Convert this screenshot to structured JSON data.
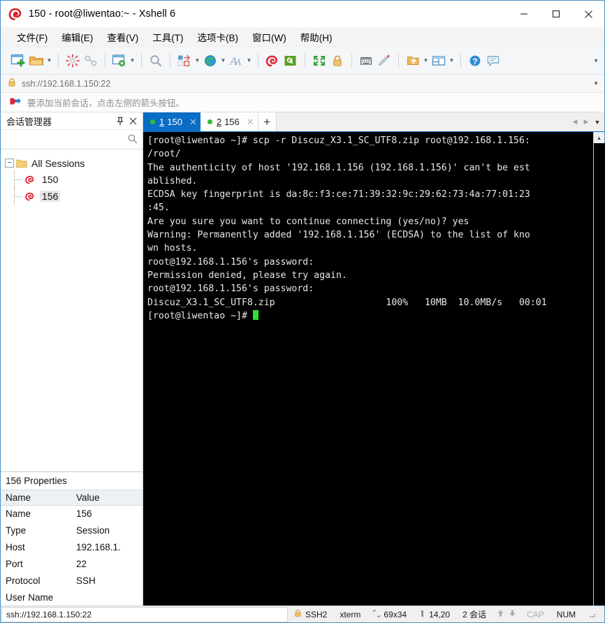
{
  "window": {
    "title": "150 - root@liwentao:~ - Xshell 6",
    "app_icon": "xshell-logo-icon",
    "controls": {
      "minimize": "—",
      "maximize": "□",
      "close": "✕"
    }
  },
  "menu": {
    "items": [
      {
        "label": "文件(F)",
        "name": "menu-file"
      },
      {
        "label": "编辑(E)",
        "name": "menu-edit"
      },
      {
        "label": "查看(V)",
        "name": "menu-view"
      },
      {
        "label": "工具(T)",
        "name": "menu-tools"
      },
      {
        "label": "选项卡(B)",
        "name": "menu-tabs"
      },
      {
        "label": "窗口(W)",
        "name": "menu-window"
      },
      {
        "label": "帮助(H)",
        "name": "menu-help"
      }
    ]
  },
  "toolbar": {
    "overflow_caret": "▼",
    "dropdown_caret": "▼",
    "buttons": [
      "new-session-icon",
      "open-folder-icon",
      "folder-dropdown",
      "sep",
      "disconnect-icon",
      "link-icon",
      "sep",
      "session-properties-icon",
      "properties-dropdown",
      "sep",
      "find-icon",
      "sep",
      "layout-icon",
      "layout-dropdown",
      "globe-icon",
      "globe-dropdown",
      "font-icon",
      "font-dropdown",
      "sep",
      "xshell-icon",
      "xftp-icon",
      "sep",
      "fullscreen-icon",
      "lock-icon",
      "sep",
      "keyboard-icon",
      "highlight-icon",
      "sep",
      "transfer-icon",
      "transfer-dropdown",
      "split-view-icon",
      "split-dropdown",
      "sep",
      "help-icon",
      "feedback-icon"
    ]
  },
  "address_bar": {
    "lock_icon": "lock-icon",
    "url": "ssh://192.168.1.150:22",
    "caret": "▼"
  },
  "notice_bar": {
    "icon": "add-session-arrow-icon",
    "text": "要添加当前会话，点击左侧的箭头按钮。"
  },
  "session_manager": {
    "title": "会话管理器",
    "pin_icon": "pin-icon",
    "close_icon": "close-icon",
    "search_icon": "search-icon",
    "search_value": "",
    "tree": {
      "toggle": "−",
      "root_label": "All Sessions",
      "root_icon": "folder-icon",
      "children": [
        {
          "label": "150",
          "icon": "session-icon",
          "selected": false
        },
        {
          "label": "156",
          "icon": "session-icon",
          "selected": true
        }
      ]
    }
  },
  "properties": {
    "title": "156 Properties",
    "headers": [
      "Name",
      "Value"
    ],
    "rows": [
      {
        "name": "Name",
        "value": "156"
      },
      {
        "name": "Type",
        "value": "Session"
      },
      {
        "name": "Host",
        "value": "192.168.1."
      },
      {
        "name": "Port",
        "value": "22"
      },
      {
        "name": "Protocol",
        "value": "SSH"
      },
      {
        "name": "User Name",
        "value": ""
      }
    ]
  },
  "tabs": {
    "items": [
      {
        "num": "1",
        "label": "150",
        "active": true,
        "close": "✕",
        "status_dot": "#2fbf2f"
      },
      {
        "num": "2",
        "label": "156",
        "active": false,
        "close": "✕",
        "status_dot": "#2fbf2f"
      }
    ],
    "add_label": "+",
    "nav_prev": "◀",
    "nav_next": "▶",
    "nav_list": "▼"
  },
  "terminal": {
    "scroll_up_arrow": "▲",
    "lines": [
      "[root@liwentao ~]# scp -r Discuz_X3.1_SC_UTF8.zip root@192.168.1.156:",
      "/root/",
      "The authenticity of host '192.168.1.156 (192.168.1.156)' can't be est",
      "ablished.",
      "ECDSA key fingerprint is da:8c:f3:ce:71:39:32:9c:29:62:73:4a:77:01:23",
      ":45.",
      "Are you sure you want to continue connecting (yes/no)? yes",
      "Warning: Permanently added '192.168.1.156' (ECDSA) to the list of kno",
      "wn hosts.",
      "root@192.168.1.156's password:",
      "Permission denied, please try again.",
      "root@192.168.1.156's password:",
      "Discuz_X3.1_SC_UTF8.zip                    100%   10MB  10.0MB/s   00:01"
    ],
    "prompt": "[root@liwentao ~]# "
  },
  "status_bar": {
    "address": "ssh://192.168.1.150:22",
    "lock_icon": "lock-icon",
    "protocol": "SSH2",
    "term_type": "xterm",
    "size_icon": "size-icon",
    "size": "69x34",
    "cursor_icon": "cursor-icon",
    "cursor_pos": "14,20",
    "sessions": "2 会话",
    "up_arrow": "⬆",
    "down_arrow": "⬇",
    "cap": "CAP",
    "num": "NUM",
    "resize_grip": "resize-grip-icon"
  },
  "colors": {
    "accent": "#0a6cc4",
    "terminal_bg": "#000000",
    "terminal_fg": "#e8e8e8",
    "cursor": "#2ee02e",
    "status_dot": "#2fbf2f"
  }
}
